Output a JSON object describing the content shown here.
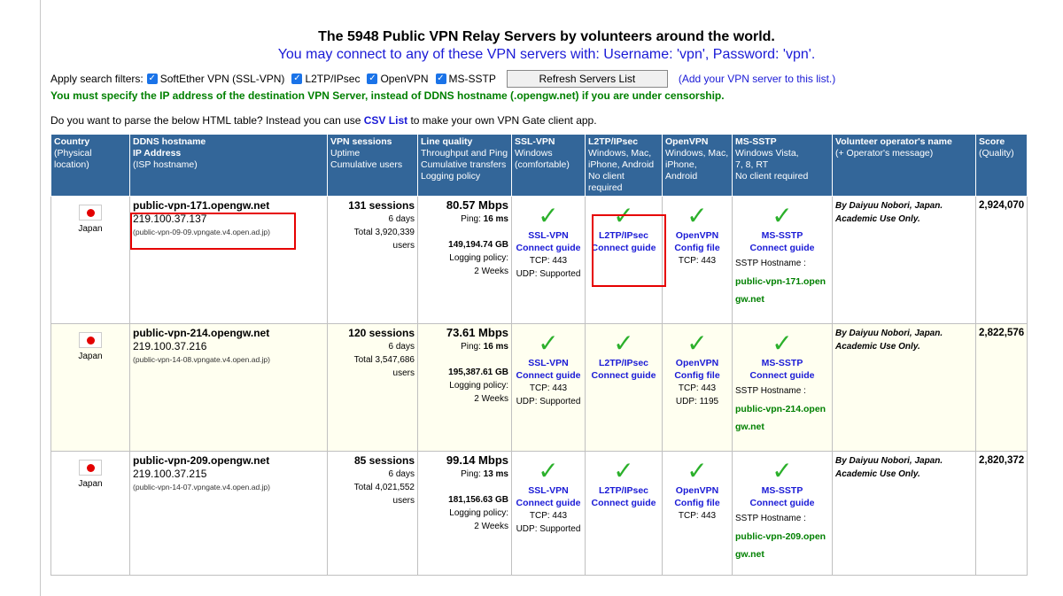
{
  "header": {
    "title": "The 5948 Public VPN Relay Servers by volunteers around the world.",
    "subtitle": "You may connect to any of these VPN servers with: Username: 'vpn', Password: 'vpn'."
  },
  "filters": {
    "label": "Apply search filters:",
    "options": [
      {
        "label": "SoftEther VPN (SSL-VPN)",
        "checked": true
      },
      {
        "label": "L2TP/IPsec",
        "checked": true
      },
      {
        "label": "OpenVPN",
        "checked": true
      },
      {
        "label": "MS-SSTP",
        "checked": true
      }
    ],
    "refresh_label": "Refresh Servers List",
    "add_link": "(Add your VPN server to this list.)"
  },
  "warning": "You must specify the IP address of the destination VPN Server, instead of DDNS hostname (.opengw.net) if you are under censorship.",
  "parse": {
    "pre": "Do you want to parse the below HTML table? Instead you can use ",
    "link": "CSV List",
    "post": " to make your own VPN Gate client app."
  },
  "columns": {
    "country": {
      "title": "Country",
      "sub": "(Physical location)"
    },
    "ddns": {
      "title": "DDNS hostname",
      "line2": "IP Address",
      "line3": "(ISP hostname)"
    },
    "sessions": {
      "title": "VPN sessions",
      "line2": "Uptime",
      "line3": "Cumulative users"
    },
    "quality": {
      "title": "Line quality",
      "line2": "Throughput and Ping",
      "line3": "Cumulative transfers",
      "line4": "Logging policy"
    },
    "ssl": {
      "title": "SSL-VPN",
      "line2": "Windows",
      "line3": "(comfortable)"
    },
    "l2tp": {
      "title": "L2TP/IPsec",
      "line2": "Windows, Mac,",
      "line3": "iPhone, Android",
      "line4": "No client required"
    },
    "openvpn": {
      "title": "OpenVPN",
      "line2": "Windows, Mac,",
      "line3": "iPhone, Android"
    },
    "sstp": {
      "title": "MS-SSTP",
      "line2": "Windows Vista,",
      "line3": "7, 8, RT",
      "line4": "No client required"
    },
    "operator": {
      "title": "Volunteer operator's name",
      "line2": "(+ Operator's message)"
    },
    "score": {
      "title": "Score",
      "line2": "(Quality)"
    }
  },
  "labels": {
    "ping": "Ping:",
    "logging": "Logging policy:",
    "ssl_name": "SSL-VPN",
    "connect_guide": "Connect guide",
    "l2tp_name": "L2TP/IPsec",
    "openvpn_name": "OpenVPN",
    "config_file": "Config file",
    "sstp_name": "MS-SSTP",
    "sstp_hostname": "SSTP Hostname :"
  },
  "rows": [
    {
      "country": "Japan",
      "host": "public-vpn-171.opengw.net",
      "ip": "219.100.37.137",
      "isp": "(public-vpn-09-09.vpngate.v4.open.ad.jp)",
      "sessions": "131 sessions",
      "uptime": "6 days",
      "total_users": "Total 3,920,339 users",
      "throughput": "80.57 Mbps",
      "ping": "16 ms",
      "transfer": "149,194.74 GB",
      "logging": "2 Weeks",
      "ssl_tcp": "TCP: 443",
      "ssl_udp": "UDP: Supported",
      "openvpn_tcp": "TCP: 443",
      "openvpn_udp": "",
      "sstp_host1": "public-vpn-171.open",
      "sstp_host2": "gw.net",
      "operator": "By Daiyuu Nobori, Japan. Academic Use Only.",
      "score": "2,924,070"
    },
    {
      "country": "Japan",
      "host": "public-vpn-214.opengw.net",
      "ip": "219.100.37.216",
      "isp": "(public-vpn-14-08.vpngate.v4.open.ad.jp)",
      "sessions": "120 sessions",
      "uptime": "6 days",
      "total_users": "Total 3,547,686 users",
      "throughput": "73.61 Mbps",
      "ping": "16 ms",
      "transfer": "195,387.61 GB",
      "logging": "2 Weeks",
      "ssl_tcp": "TCP: 443",
      "ssl_udp": "UDP: Supported",
      "openvpn_tcp": "TCP: 443",
      "openvpn_udp": "UDP: 1195",
      "sstp_host1": "public-vpn-214.open",
      "sstp_host2": "gw.net",
      "operator": "By Daiyuu Nobori, Japan. Academic Use Only.",
      "score": "2,822,576"
    },
    {
      "country": "Japan",
      "host": "public-vpn-209.opengw.net",
      "ip": "219.100.37.215",
      "isp": "(public-vpn-14-07.vpngate.v4.open.ad.jp)",
      "sessions": "85 sessions",
      "uptime": "6 days",
      "total_users": "Total 4,021,552 users",
      "throughput": "99.14 Mbps",
      "ping": "13 ms",
      "transfer": "181,156.63 GB",
      "logging": "2 Weeks",
      "ssl_tcp": "TCP: 443",
      "ssl_udp": "UDP: Supported",
      "openvpn_tcp": "TCP: 443",
      "openvpn_udp": "",
      "sstp_host1": "public-vpn-209.open",
      "sstp_host2": "gw.net",
      "operator": "By Daiyuu Nobori, Japan. Academic Use Only.",
      "score": "2,820,372"
    }
  ]
}
